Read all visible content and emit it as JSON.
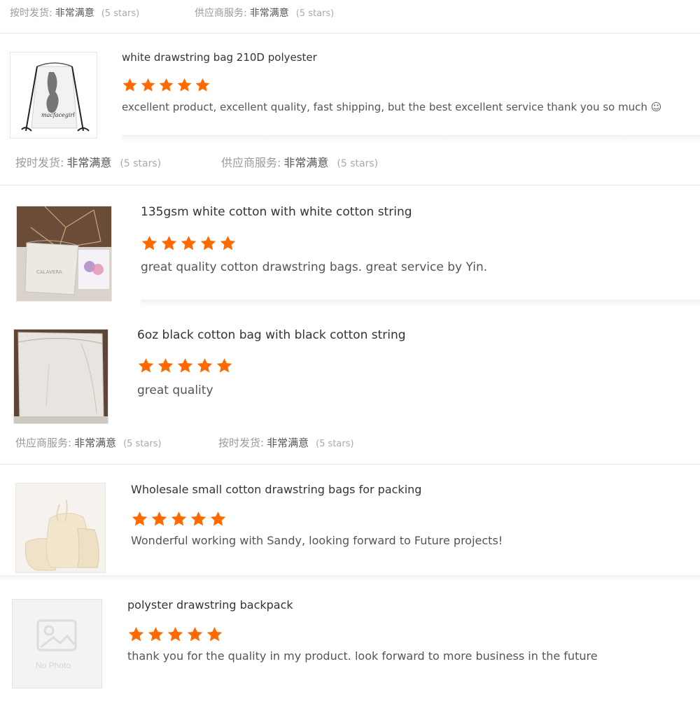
{
  "meta_rows": [
    {
      "items": [
        {
          "label": "按时发货:",
          "value": "非常满意",
          "stars": "(5 stars)"
        },
        {
          "label": "供应商服务:",
          "value": "非常满意",
          "stars": "(5 stars)"
        }
      ]
    },
    {
      "items": [
        {
          "label": "按时发货:",
          "value": "非常满意",
          "stars": "(5 stars)"
        },
        {
          "label": "供应商服务:",
          "value": "非常满意",
          "stars": "(5 stars)"
        }
      ]
    },
    {
      "items": [
        {
          "label": "供应商服务:",
          "value": "非常满意",
          "stars": "(5 stars)"
        },
        {
          "label": "按时发货:",
          "value": "非常满意",
          "stars": "(5 stars)"
        }
      ]
    }
  ],
  "reviews": [
    {
      "title": "white drawstring bag 210D polyester",
      "rating": 5,
      "comment": "excellent product, excellent quality, fast shipping, but the best excellent service thank you so much ☺",
      "thumb_text": "macfacegirl"
    },
    {
      "title": "135gsm white cotton with white cotton string",
      "rating": 5,
      "comment": "great quality cotton drawstring bags. great service by Yin.",
      "thumb_text": "CALAVERA"
    },
    {
      "title": "6oz black cotton bag with black cotton string",
      "rating": 5,
      "comment": "great quality"
    },
    {
      "title": "Wholesale small cotton drawstring bags for packing",
      "rating": 5,
      "comment": "Wonderful working with Sandy, looking forward to Future projects!"
    },
    {
      "title": "polyster drawstring backpack",
      "rating": 5,
      "comment": "thank you for the quality in my product. look forward to more business in the future",
      "thumb_text": "No Photo"
    }
  ],
  "colors": {
    "star": "#ff6a00",
    "divider": "#e3e3e3",
    "muted": "#9a9a9a"
  }
}
